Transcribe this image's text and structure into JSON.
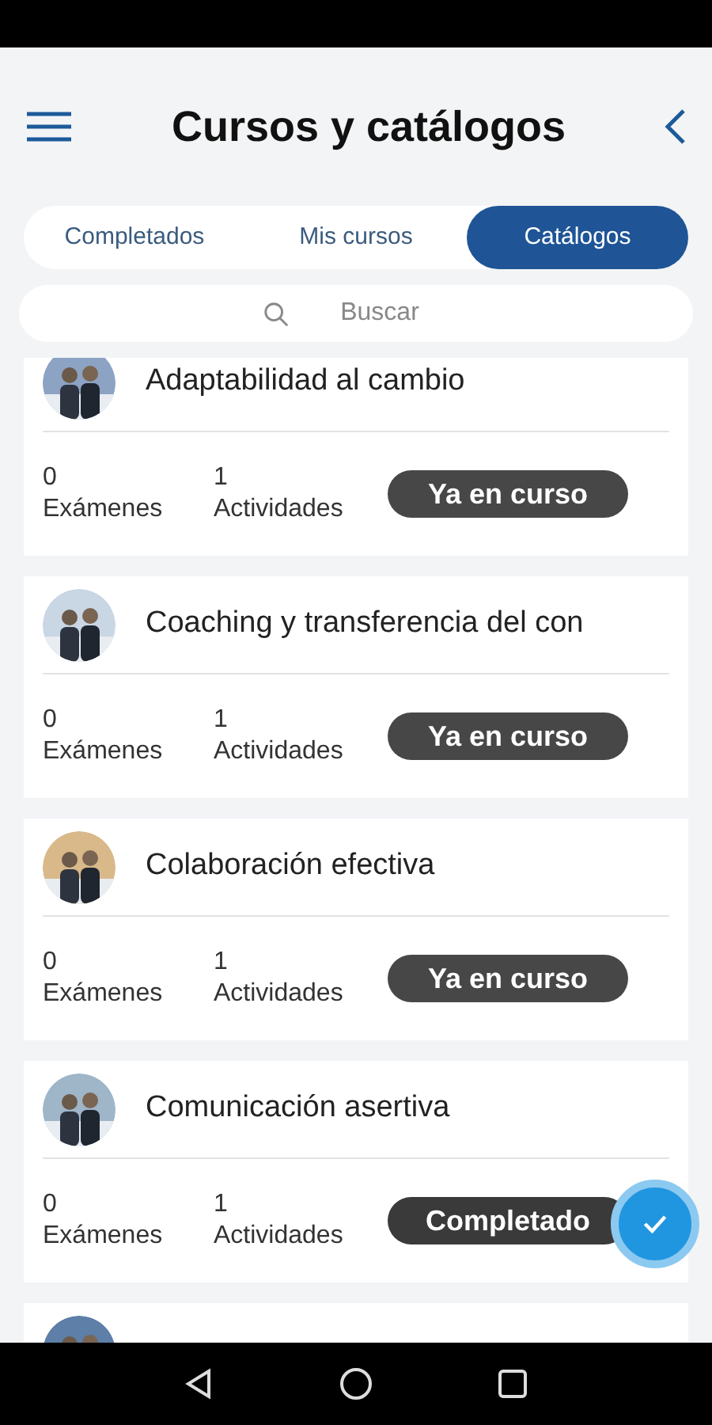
{
  "header": {
    "title": "Cursos y catálogos"
  },
  "tabs": [
    {
      "label": "Completados",
      "selected": false
    },
    {
      "label": "Mis cursos",
      "selected": false
    },
    {
      "label": "Catálogos",
      "selected": true
    }
  ],
  "search": {
    "placeholder": "Buscar"
  },
  "courses": [
    {
      "title": "Adaptabilidad al cambio",
      "exams": "0",
      "exams_label": "Exámenes",
      "activities": "1",
      "activities_label": "Actividades",
      "status": "Ya en curso",
      "done": false
    },
    {
      "title": "Coaching y transferencia del con",
      "exams": "0",
      "exams_label": "Exámenes",
      "activities": "1",
      "activities_label": "Actividades",
      "status": "Ya en curso",
      "done": false
    },
    {
      "title": "Colaboración efectiva",
      "exams": "0",
      "exams_label": "Exámenes",
      "activities": "1",
      "activities_label": "Actividades",
      "status": "Ya en curso",
      "done": false
    },
    {
      "title": "Comunicación asertiva",
      "exams": "0",
      "exams_label": "Exámenes",
      "activities": "1",
      "activities_label": "Actividades",
      "status": "Completado",
      "done": true
    }
  ],
  "more_below": true
}
